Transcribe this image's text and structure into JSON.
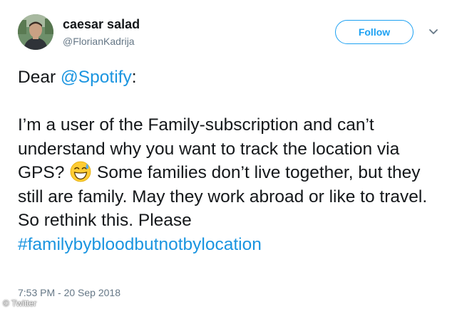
{
  "author": {
    "display_name": "caesar salad",
    "handle": "@FlorianKadrija"
  },
  "actions": {
    "follow_label": "Follow"
  },
  "tweet": {
    "line1_prefix": "Dear ",
    "mention": "@Spotify",
    "line1_suffix": ":",
    "body_part1": "I’m a user of the Family-subscription and can’t understand why you want to track the location via GPS?",
    "emoji": "grinning-face-with-sweat-emoji",
    "body_part2": "Some families don’t live together, but they still are family. May they work abroad or like to travel. So rethink this. Please",
    "hashtag": "#familybybloodbutnotbylocation",
    "timestamp": "7:53 PM - 20 Sep 2018"
  },
  "image_credit": "© Twitter",
  "colors": {
    "link": "#1b95e0",
    "follow_border": "#1da1f2",
    "secondary_text": "#657786",
    "primary_text": "#14171a"
  }
}
